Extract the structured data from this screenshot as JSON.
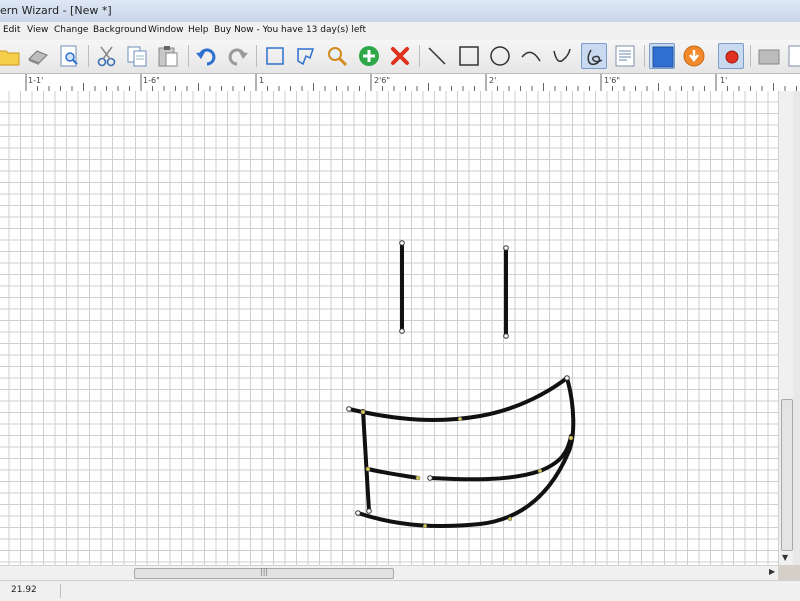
{
  "window": {
    "title": "ern Wizard - [New *]"
  },
  "menu": {
    "items": [
      "Edit",
      "View",
      "Change",
      "Background",
      "Window",
      "Help",
      "Buy Now - You have 13 day(s) left"
    ]
  },
  "toolbar": {
    "tools": [
      {
        "name": "open-folder-icon"
      },
      {
        "name": "eraser-icon"
      },
      {
        "name": "print-preview-icon"
      },
      {
        "name": "cut-icon"
      },
      {
        "name": "copy-icon"
      },
      {
        "name": "paste-icon"
      },
      {
        "name": "undo-icon"
      },
      {
        "name": "redo-icon"
      },
      {
        "name": "select-rectangle-icon"
      },
      {
        "name": "select-lasso-icon"
      },
      {
        "name": "zoom-icon"
      },
      {
        "name": "add-point-icon"
      },
      {
        "name": "delete-icon"
      },
      {
        "name": "line-tool-icon"
      },
      {
        "name": "rectangle-tool-icon"
      },
      {
        "name": "circle-tool-icon"
      },
      {
        "name": "arc-tool-icon"
      },
      {
        "name": "curve-tool-icon"
      },
      {
        "name": "freehand-tool-icon",
        "selected": true
      },
      {
        "name": "properties-icon"
      },
      {
        "name": "fill-icon"
      },
      {
        "name": "import-icon"
      },
      {
        "name": "record-icon"
      },
      {
        "name": "folder-gray-icon"
      },
      {
        "name": "list-icon"
      }
    ]
  },
  "ruler": {
    "labels": [
      "1-1'",
      "1-6\"",
      "1",
      "2'6\"",
      "2'",
      "1'6\"",
      "1'"
    ]
  },
  "status": {
    "value": "21.92"
  },
  "colors": {
    "canvas": "#ffffff",
    "grid": "#cfcfcf",
    "stroke": "#111111",
    "accent": "#2f6fd0"
  }
}
